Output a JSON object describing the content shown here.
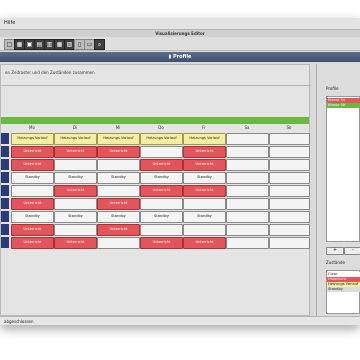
{
  "menu": {
    "help": "Hilfe"
  },
  "window": {
    "title": "Visualisierungs Editor"
  },
  "header": {
    "title": "Profile"
  },
  "main": {
    "description": "en Zeitraster und den Zuständen zusammen",
    "days": [
      "Mo",
      "Di",
      "Mi",
      "Do",
      "Fr",
      "Sa",
      "So"
    ]
  },
  "grid": [
    [
      "Heizungs Vorlauf",
      "Heizungs Vorlauf",
      "Heizungs Vorlauf",
      "Heizungs Vorlauf",
      "Heizungs Vorlauf",
      "",
      ""
    ],
    [
      "Unterricht",
      "Unterricht",
      "Unterricht",
      "",
      "Unterricht",
      "",
      ""
    ],
    [
      "Unterricht",
      "",
      "",
      "Unterricht",
      "Unterricht",
      "",
      ""
    ],
    [
      "Standby",
      "Standby",
      "Standby",
      "Standby",
      "Standby",
      "",
      ""
    ],
    [
      "",
      "Unterricht",
      "",
      "Unterricht",
      "Unterricht",
      "",
      ""
    ],
    [
      "Unterricht",
      "",
      "Unterricht",
      "",
      "",
      "",
      ""
    ],
    [
      "Standby",
      "Standby",
      "Standby",
      "Standby",
      "Standby",
      "",
      ""
    ],
    [
      "Unterricht",
      "",
      "Unterricht",
      "",
      "",
      "",
      ""
    ],
    [
      "Unterricht",
      "Unterricht",
      "",
      "Unterricht",
      "Unterricht",
      "",
      ""
    ]
  ],
  "profiles": {
    "label": "Profile",
    "items": [
      "Klasse 5a",
      "Klasse 5b"
    ],
    "add": "+",
    "remove": "-"
  },
  "states": {
    "label": "Zustände",
    "items": [
      "Clear",
      "Unterricht",
      "Heizungs Vorlauf",
      "Standby"
    ]
  },
  "status": {
    "text": "abgeschlossen"
  },
  "colors": {
    "heizung": "#f4eea2",
    "unterricht": "#e2555b",
    "standby": "#f4f4f4",
    "green": "#6ab83f",
    "header": "#4a5a79"
  }
}
